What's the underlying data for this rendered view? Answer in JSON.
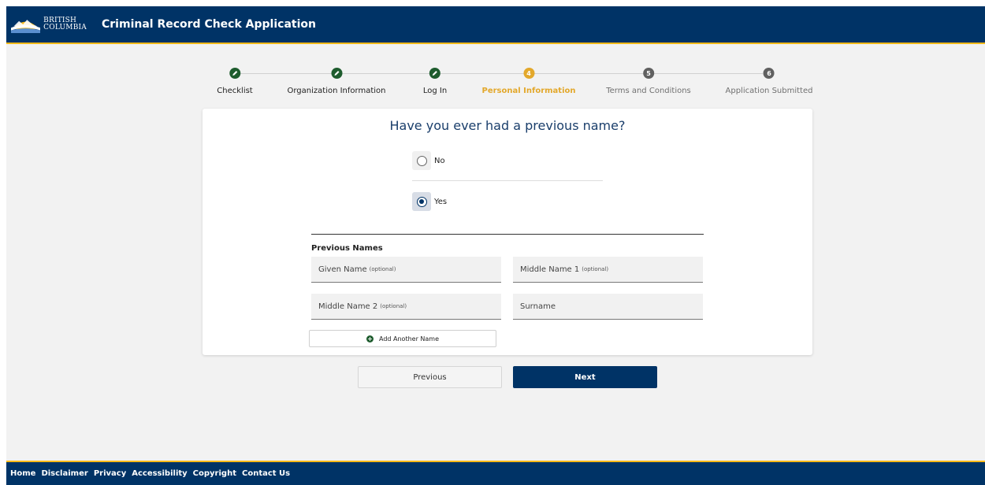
{
  "header": {
    "logo_line1": "BRITISH",
    "logo_line2": "COLUMBIA",
    "title": "Criminal Record Check Application"
  },
  "stepper": {
    "steps": [
      {
        "label": "Checklist",
        "state": "done",
        "marker": ""
      },
      {
        "label": "Organization Information",
        "state": "done",
        "marker": ""
      },
      {
        "label": "Log In",
        "state": "done",
        "marker": ""
      },
      {
        "label": "Personal Information",
        "state": "active",
        "marker": "4"
      },
      {
        "label": "Terms and Conditions",
        "state": "todo",
        "marker": "5"
      },
      {
        "label": "Application Submitted",
        "state": "todo",
        "marker": "6"
      }
    ]
  },
  "form": {
    "question": "Have you ever had a previous name?",
    "options": [
      {
        "label": "No",
        "checked": false
      },
      {
        "label": "Yes",
        "checked": true
      }
    ],
    "section_label": "Previous Names",
    "fields": {
      "given_name": {
        "label": "Given Name",
        "hint": "(optional)"
      },
      "middle_name_1": {
        "label": "Middle Name 1",
        "hint": "(optional)"
      },
      "middle_name_2": {
        "label": "Middle Name 2",
        "hint": "(optional)"
      },
      "surname": {
        "label": "Surname",
        "hint": ""
      }
    },
    "add_button_label": "Add Another Name"
  },
  "nav": {
    "previous_label": "Previous",
    "next_label": "Next"
  },
  "footer": {
    "links": [
      "Home",
      "Disclaimer",
      "Privacy",
      "Accessibility",
      "Copyright",
      "Contact Us"
    ]
  },
  "colors": {
    "brand_blue": "#003366",
    "brand_gold": "#fcba19",
    "step_done": "#1e5c2e",
    "step_active": "#e3a82b",
    "step_todo": "#606060"
  }
}
